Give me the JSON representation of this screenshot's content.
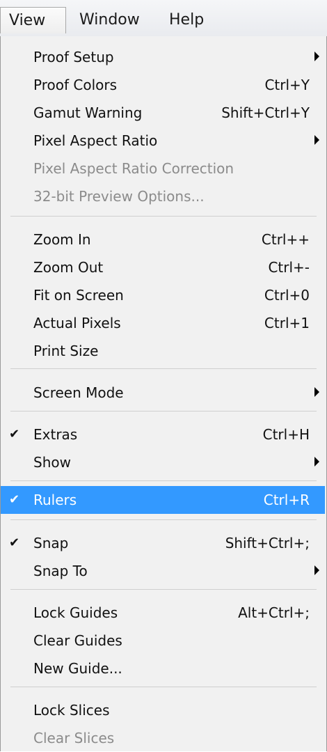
{
  "menubar": {
    "items": [
      {
        "label": "View"
      },
      {
        "label": "Window"
      },
      {
        "label": "Help"
      }
    ]
  },
  "menu": {
    "items": [
      {
        "label": "Proof Setup",
        "shortcut": "",
        "submenu": true
      },
      {
        "label": "Proof Colors",
        "shortcut": "Ctrl+Y"
      },
      {
        "label": "Gamut Warning",
        "shortcut": "Shift+Ctrl+Y"
      },
      {
        "label": "Pixel Aspect Ratio",
        "shortcut": "",
        "submenu": true
      },
      {
        "label": "Pixel Aspect Ratio Correction",
        "shortcut": "",
        "disabled": true
      },
      {
        "label": "32-bit Preview Options...",
        "shortcut": "",
        "disabled": true
      },
      {
        "label": "Zoom In",
        "shortcut": "Ctrl++"
      },
      {
        "label": "Zoom Out",
        "shortcut": "Ctrl+-"
      },
      {
        "label": "Fit on Screen",
        "shortcut": "Ctrl+0"
      },
      {
        "label": "Actual Pixels",
        "shortcut": "Ctrl+1"
      },
      {
        "label": "Print Size",
        "shortcut": ""
      },
      {
        "label": "Screen Mode",
        "shortcut": "",
        "submenu": true
      },
      {
        "label": "Extras",
        "shortcut": "Ctrl+H",
        "checked": true
      },
      {
        "label": "Show",
        "shortcut": "",
        "submenu": true
      },
      {
        "label": "Rulers",
        "shortcut": "Ctrl+R",
        "checked": true,
        "highlighted": true
      },
      {
        "label": "Snap",
        "shortcut": "Shift+Ctrl+;",
        "checked": true
      },
      {
        "label": "Snap To",
        "shortcut": "",
        "submenu": true
      },
      {
        "label": "Lock Guides",
        "shortcut": "Alt+Ctrl+;"
      },
      {
        "label": "Clear Guides",
        "shortcut": ""
      },
      {
        "label": "New Guide...",
        "shortcut": ""
      },
      {
        "label": "Lock Slices",
        "shortcut": ""
      },
      {
        "label": "Clear Slices",
        "shortcut": "",
        "disabled": true
      }
    ]
  },
  "icons": {
    "check": "check-icon",
    "submenu": "submenu-arrow-icon"
  },
  "colors": {
    "highlight": "#3399ff",
    "disabled_text": "#8b8b8b",
    "menu_bg": "#f1f1f1"
  }
}
